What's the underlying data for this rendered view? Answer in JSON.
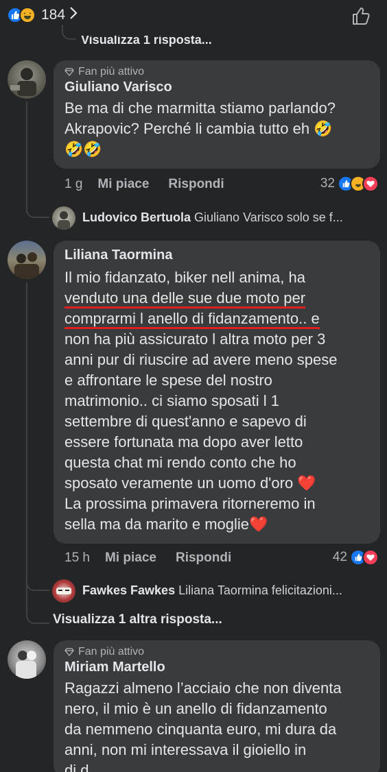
{
  "top": {
    "reaction_count": "184"
  },
  "view_reply_top": "Visualizza 1 risposta...",
  "comments": [
    {
      "badge": "Fan più attivo",
      "author": "Giuliano Varisco",
      "lines": [
        "Be ma di che marmitta stiamo parlando?",
        "Akrapovic? Perché li cambia tutto eh 🤣",
        "🤣🤣"
      ],
      "time": "1 g",
      "like": "Mi piace",
      "reply": "Rispondi",
      "reactions": "32"
    },
    {
      "author": "Liliana Taormina",
      "lines": [
        "Il mio fidanzato, biker nell anima, ha",
        "venduto una delle sue due moto per",
        "comprarmi l anello di fidanzamento.. e",
        "non ha più assicurato l altra moto per 3",
        "anni pur di riuscire ad avere meno spese",
        "e affrontare le spese del nostro",
        "matrimonio.. ci siamo sposati l 1",
        "settembre di quest'anno e sapevo di",
        "essere fortunata ma dopo aver letto",
        "questa chat mi rendo conto che ho",
        "sposato veramente un uomo d'oro ❤️",
        "La prossima primavera ritorneremo in",
        "sella ma da marito e moglie❤️"
      ],
      "time": "15 h",
      "like": "Mi piace",
      "reply": "Rispondi",
      "reactions": "42"
    },
    {
      "badge": "Fan più attivo",
      "author": "Miriam Martello",
      "lines": [
        "Ragazzi almeno l’acciaio che non diventa",
        "nero, il mio è un anello di fidanzamento",
        "da nemmeno cinquanta euro, mi dura da",
        "anni, non mi interessava il gioiello in",
        "di                                        d"
      ]
    }
  ],
  "replies": [
    {
      "author": "Ludovico Bertuola",
      "text": "Giuliano Varisco solo se f..."
    },
    {
      "author": "Fawkes Fawkes",
      "text": "Liliana Taormina felicitazioni..."
    }
  ],
  "view_other_reply": "Visualizza 1 altra risposta...",
  "colors": {
    "bg": "#242526",
    "bubble": "#3a3b3c",
    "like_blue": "#1877f2",
    "love_red": "#f33e58",
    "underline": "#e02020"
  }
}
